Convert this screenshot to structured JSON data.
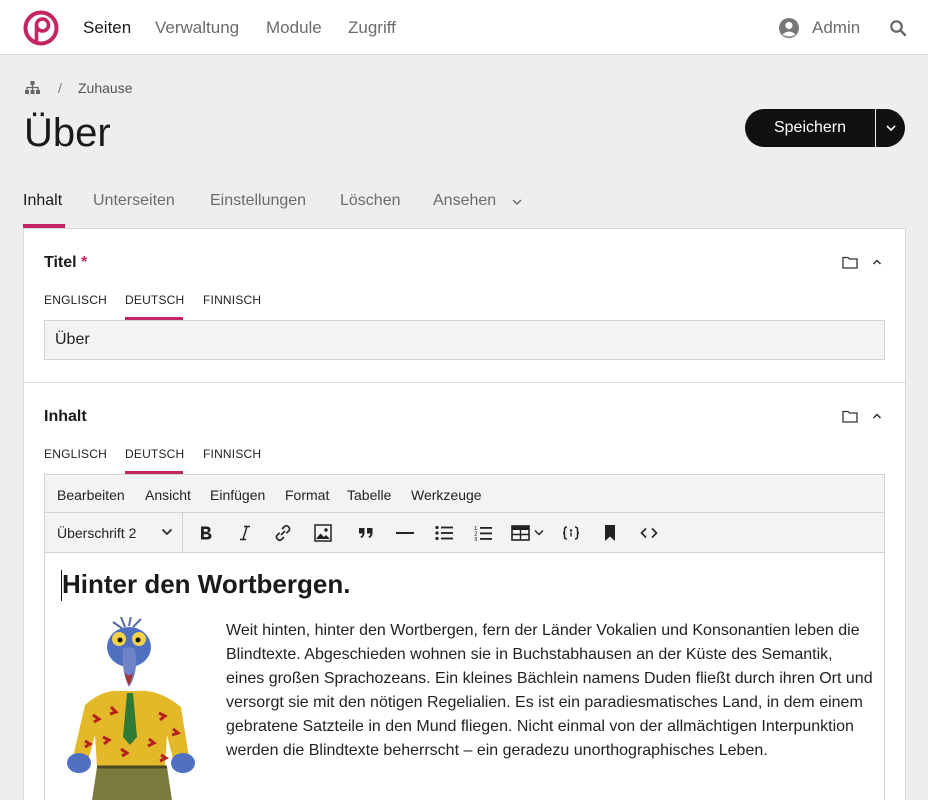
{
  "nav": {
    "items": [
      {
        "label": "Seiten"
      },
      {
        "label": "Verwaltung"
      },
      {
        "label": "Module"
      },
      {
        "label": "Zugriff"
      }
    ],
    "user": "Admin"
  },
  "breadcrumb": {
    "separator": "/",
    "link": "Zuhause"
  },
  "page": {
    "title": "Über"
  },
  "actions": {
    "save_label": "Speichern"
  },
  "tabs": [
    {
      "label": "Inhalt"
    },
    {
      "label": "Unterseiten"
    },
    {
      "label": "Einstellungen"
    },
    {
      "label": "Löschen"
    },
    {
      "label": "Ansehen"
    }
  ],
  "fields": {
    "title": {
      "label": "Titel",
      "required_mark": "*",
      "languages": [
        "ENGLISCH",
        "DEUTSCH",
        "FINNISCH"
      ],
      "active_language": "DEUTSCH",
      "value": "Über"
    },
    "content": {
      "label": "Inhalt",
      "languages": [
        "ENGLISCH",
        "DEUTSCH",
        "FINNISCH"
      ],
      "active_language": "DEUTSCH"
    }
  },
  "editor": {
    "menus": [
      "Bearbeiten",
      "Ansicht",
      "Einfügen",
      "Format",
      "Tabelle",
      "Werkzeuge"
    ],
    "block_format": "Überschrift 2",
    "toolbar_icons": [
      "bold-icon",
      "italic-icon",
      "link-icon",
      "image-icon",
      "blockquote-icon",
      "horizontal-rule-icon",
      "bullet-list-icon",
      "numbered-list-icon",
      "table-icon",
      "code-sample-icon",
      "bookmark-icon",
      "source-code-icon"
    ],
    "heading": "Hinter den Wortbergen.",
    "paragraph": "Weit hinten, hinter den Wortbergen, fern der Länder Vokalien und Konsonantien leben die Blindtexte. Abgeschieden wohnen sie in Buchstabhausen an der Küste des Semantik, eines großen Sprachozeans. Ein kleines Bächlein namens Duden fließt durch ihren Ort und versorgt sie mit den nötigen Regelialien. Es ist ein paradiesmatisches Land, in dem einem gebratene Satzteile in den Mund fliegen. Nicht einmal von der allmächtigen Interpunktion werden die Blindtexte beherrscht – ein geradezu unorthographisches Leben."
  },
  "colors": {
    "accent": "#c32462",
    "button": "#111111",
    "background": "#eeeeee"
  }
}
